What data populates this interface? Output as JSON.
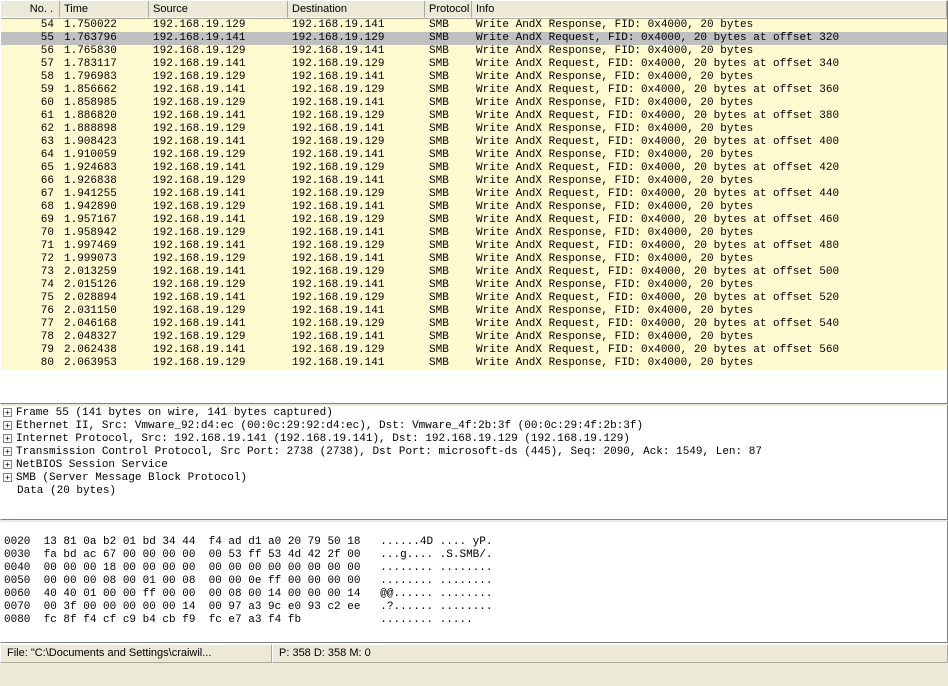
{
  "columns": {
    "no": "No. .",
    "time": "Time",
    "src": "Source",
    "dst": "Destination",
    "proto": "Protocol",
    "info": "Info"
  },
  "selected_no": 55,
  "packets": [
    {
      "no": 54,
      "time": "1.750022",
      "src": "192.168.19.129",
      "dst": "192.168.19.141",
      "proto": "SMB",
      "info": "Write AndX Response, FID: 0x4000, 20 bytes"
    },
    {
      "no": 55,
      "time": "1.763796",
      "src": "192.168.19.141",
      "dst": "192.168.19.129",
      "proto": "SMB",
      "info": "Write AndX Request, FID: 0x4000, 20 bytes at offset 320"
    },
    {
      "no": 56,
      "time": "1.765830",
      "src": "192.168.19.129",
      "dst": "192.168.19.141",
      "proto": "SMB",
      "info": "Write AndX Response, FID: 0x4000, 20 bytes"
    },
    {
      "no": 57,
      "time": "1.783117",
      "src": "192.168.19.141",
      "dst": "192.168.19.129",
      "proto": "SMB",
      "info": "Write AndX Request, FID: 0x4000, 20 bytes at offset 340"
    },
    {
      "no": 58,
      "time": "1.796983",
      "src": "192.168.19.129",
      "dst": "192.168.19.141",
      "proto": "SMB",
      "info": "Write AndX Response, FID: 0x4000, 20 bytes"
    },
    {
      "no": 59,
      "time": "1.856662",
      "src": "192.168.19.141",
      "dst": "192.168.19.129",
      "proto": "SMB",
      "info": "Write AndX Request, FID: 0x4000, 20 bytes at offset 360"
    },
    {
      "no": 60,
      "time": "1.858985",
      "src": "192.168.19.129",
      "dst": "192.168.19.141",
      "proto": "SMB",
      "info": "Write AndX Response, FID: 0x4000, 20 bytes"
    },
    {
      "no": 61,
      "time": "1.886820",
      "src": "192.168.19.141",
      "dst": "192.168.19.129",
      "proto": "SMB",
      "info": "Write AndX Request, FID: 0x4000, 20 bytes at offset 380"
    },
    {
      "no": 62,
      "time": "1.888898",
      "src": "192.168.19.129",
      "dst": "192.168.19.141",
      "proto": "SMB",
      "info": "Write AndX Response, FID: 0x4000, 20 bytes"
    },
    {
      "no": 63,
      "time": "1.908423",
      "src": "192.168.19.141",
      "dst": "192.168.19.129",
      "proto": "SMB",
      "info": "Write AndX Request, FID: 0x4000, 20 bytes at offset 400"
    },
    {
      "no": 64,
      "time": "1.910059",
      "src": "192.168.19.129",
      "dst": "192.168.19.141",
      "proto": "SMB",
      "info": "Write AndX Response, FID: 0x4000, 20 bytes"
    },
    {
      "no": 65,
      "time": "1.924683",
      "src": "192.168.19.141",
      "dst": "192.168.19.129",
      "proto": "SMB",
      "info": "Write AndX Request, FID: 0x4000, 20 bytes at offset 420"
    },
    {
      "no": 66,
      "time": "1.926838",
      "src": "192.168.19.129",
      "dst": "192.168.19.141",
      "proto": "SMB",
      "info": "Write AndX Response, FID: 0x4000, 20 bytes"
    },
    {
      "no": 67,
      "time": "1.941255",
      "src": "192.168.19.141",
      "dst": "192.168.19.129",
      "proto": "SMB",
      "info": "Write AndX Request, FID: 0x4000, 20 bytes at offset 440"
    },
    {
      "no": 68,
      "time": "1.942890",
      "src": "192.168.19.129",
      "dst": "192.168.19.141",
      "proto": "SMB",
      "info": "Write AndX Response, FID: 0x4000, 20 bytes"
    },
    {
      "no": 69,
      "time": "1.957167",
      "src": "192.168.19.141",
      "dst": "192.168.19.129",
      "proto": "SMB",
      "info": "Write AndX Request, FID: 0x4000, 20 bytes at offset 460"
    },
    {
      "no": 70,
      "time": "1.958942",
      "src": "192.168.19.129",
      "dst": "192.168.19.141",
      "proto": "SMB",
      "info": "Write AndX Response, FID: 0x4000, 20 bytes"
    },
    {
      "no": 71,
      "time": "1.997469",
      "src": "192.168.19.141",
      "dst": "192.168.19.129",
      "proto": "SMB",
      "info": "Write AndX Request, FID: 0x4000, 20 bytes at offset 480"
    },
    {
      "no": 72,
      "time": "1.999073",
      "src": "192.168.19.129",
      "dst": "192.168.19.141",
      "proto": "SMB",
      "info": "Write AndX Response, FID: 0x4000, 20 bytes"
    },
    {
      "no": 73,
      "time": "2.013259",
      "src": "192.168.19.141",
      "dst": "192.168.19.129",
      "proto": "SMB",
      "info": "Write AndX Request, FID: 0x4000, 20 bytes at offset 500"
    },
    {
      "no": 74,
      "time": "2.015126",
      "src": "192.168.19.129",
      "dst": "192.168.19.141",
      "proto": "SMB",
      "info": "Write AndX Response, FID: 0x4000, 20 bytes"
    },
    {
      "no": 75,
      "time": "2.028894",
      "src": "192.168.19.141",
      "dst": "192.168.19.129",
      "proto": "SMB",
      "info": "Write AndX Request, FID: 0x4000, 20 bytes at offset 520"
    },
    {
      "no": 76,
      "time": "2.031150",
      "src": "192.168.19.129",
      "dst": "192.168.19.141",
      "proto": "SMB",
      "info": "Write AndX Response, FID: 0x4000, 20 bytes"
    },
    {
      "no": 77,
      "time": "2.046168",
      "src": "192.168.19.141",
      "dst": "192.168.19.129",
      "proto": "SMB",
      "info": "Write AndX Request, FID: 0x4000, 20 bytes at offset 540"
    },
    {
      "no": 78,
      "time": "2.048327",
      "src": "192.168.19.129",
      "dst": "192.168.19.141",
      "proto": "SMB",
      "info": "Write AndX Response, FID: 0x4000, 20 bytes"
    },
    {
      "no": 79,
      "time": "2.062438",
      "src": "192.168.19.141",
      "dst": "192.168.19.129",
      "proto": "SMB",
      "info": "Write AndX Request, FID: 0x4000, 20 bytes at offset 560"
    },
    {
      "no": 80,
      "time": "2.063953",
      "src": "192.168.19.129",
      "dst": "192.168.19.141",
      "proto": "SMB",
      "info": "Write AndX Response, FID: 0x4000, 20 bytes"
    }
  ],
  "details": [
    "Frame 55 (141 bytes on wire, 141 bytes captured)",
    "Ethernet II, Src: Vmware_92:d4:ec (00:0c:29:92:d4:ec), Dst: Vmware_4f:2b:3f (00:0c:29:4f:2b:3f)",
    "Internet Protocol, Src: 192.168.19.141 (192.168.19.141), Dst: 192.168.19.129 (192.168.19.129)",
    "Transmission Control Protocol, Src Port: 2738 (2738), Dst Port: microsoft-ds (445), Seq: 2090, Ack: 1549, Len: 87",
    "NetBIOS Session Service",
    "SMB (Server Message Block Protocol)"
  ],
  "data_line": "Data (20 bytes)",
  "hex": [
    {
      "off": "0020",
      "b": "13 81 0a b2 01 bd 34 44  f4 ad d1 a0 20 79 50 18",
      "a": "......4D .... yP."
    },
    {
      "off": "0030",
      "b": "fa bd ac 67 00 00 00 00  00 53 ff 53 4d 42 2f 00",
      "a": "...g.... .S.SMB/."
    },
    {
      "off": "0040",
      "b": "00 00 00 18 00 00 00 00  00 00 00 00 00 00 00 00",
      "a": "........ ........"
    },
    {
      "off": "0050",
      "b": "00 00 00 08 00 01 00 08  00 00 0e ff 00 00 00 00",
      "a": "........ ........"
    },
    {
      "off": "0060",
      "b": "40 40 01 00 00 ff 00 00  00 08 00 14 00 00 00 14",
      "a": "@@...... ........"
    },
    {
      "off": "0070",
      "b": "00 3f 00 00 00 00 00 14  00 97 a3 9c e0 93 c2 ee",
      "a": ".?...... ........"
    },
    {
      "off": "0080",
      "b": "fc 8f f4 cf c9 b4 cb f9  fc e7 a3 f4 fb         ",
      "a": "........ ....."
    }
  ],
  "statusbar": {
    "file": "File: \"C:\\Documents and Settings\\craiwil...",
    "counts": "P: 358 D: 358 M: 0"
  }
}
